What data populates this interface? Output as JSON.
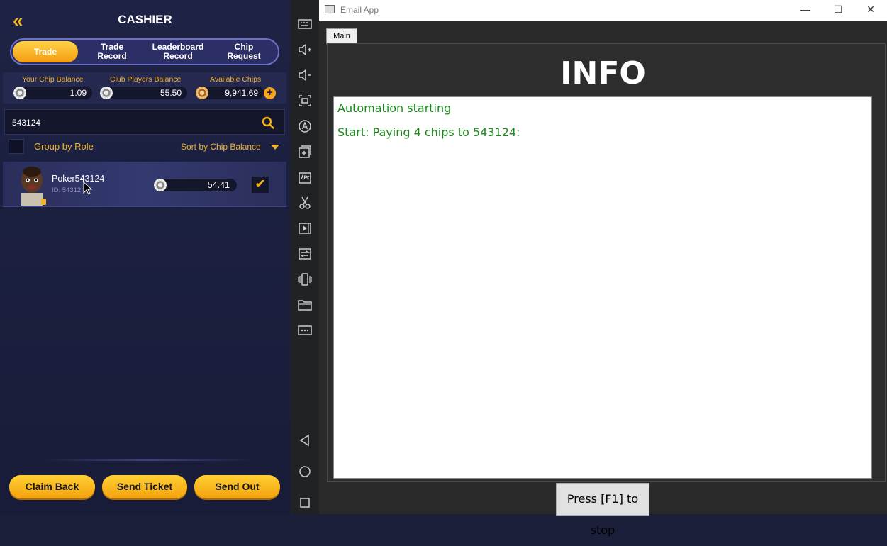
{
  "cashier": {
    "title": "CASHIER",
    "back_icon": "double-chevron-left-icon",
    "tabs": [
      "Trade",
      "Trade\nRecord",
      "Leaderboard\nRecord",
      "Chip\nRequest"
    ],
    "balances": {
      "your_label": "Your Chip Balance",
      "your_value": "1.09",
      "club_label": "Club Players Balance",
      "club_value": "55.50",
      "available_label": "Available Chips",
      "available_value": "9,941.69",
      "add_label": "+"
    },
    "search": {
      "value": "543124"
    },
    "group_label": "Group by Role",
    "sort_label": "Sort by Chip Balance",
    "player": {
      "name": "Poker543124",
      "id": "ID: 54312",
      "chips": "54.41",
      "check": "✔"
    },
    "buttons": {
      "claim": "Claim Back",
      "ticket": "Send Ticket",
      "send": "Send Out"
    }
  },
  "window": {
    "title": "Email App",
    "minimize": "—",
    "maximize": "☐",
    "close": "✕",
    "tab": "Main",
    "heading": "INFO",
    "log": [
      "Automation starting",
      "Start: Paying 4 chips to 543124:"
    ],
    "stop_button": "Press [F1] to stop"
  }
}
